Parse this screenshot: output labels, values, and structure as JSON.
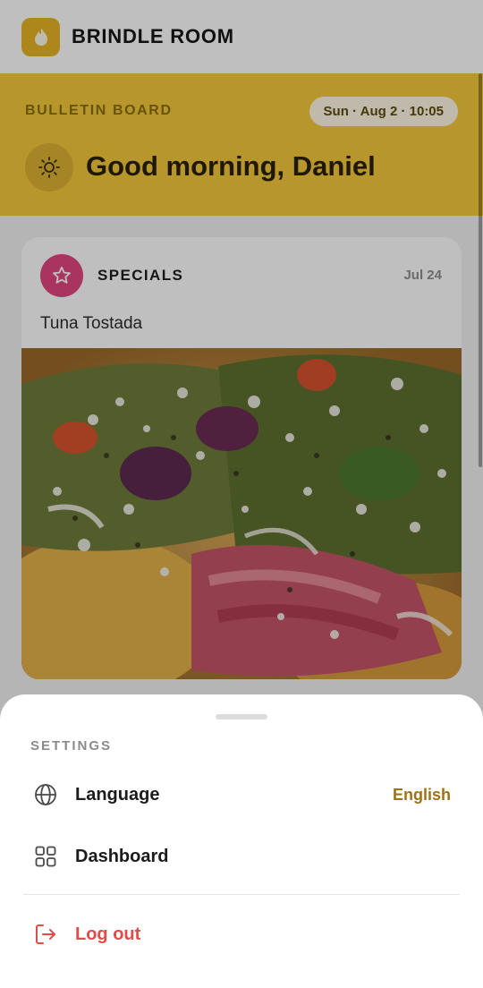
{
  "app": {
    "brand": "BRINDLE ROOM",
    "logo_icon": "flame-icon",
    "accent_color": "#e9b526"
  },
  "bulletin": {
    "label": "BULLETIN BOARD",
    "date_time": "Sun · Aug 2 · 10:05",
    "weather_icon": "sun-icon",
    "greeting": "Good morning, Daniel",
    "background_color": "#f4ca3a"
  },
  "feed": {
    "cards": [
      {
        "category": "SPECIALS",
        "category_icon": "star-icon",
        "category_color": "#e0467f",
        "date": "Jul 24",
        "title": "Tuna Tostada",
        "image": "tuna-tostada-photo"
      }
    ]
  },
  "settings_sheet": {
    "title": "SETTINGS",
    "items": [
      {
        "label": "Language",
        "icon": "globe-icon",
        "value": "English"
      },
      {
        "label": "Dashboard",
        "icon": "grid-icon"
      }
    ],
    "logout": {
      "label": "Log out",
      "icon": "logout-icon",
      "color": "#e14b48"
    }
  }
}
